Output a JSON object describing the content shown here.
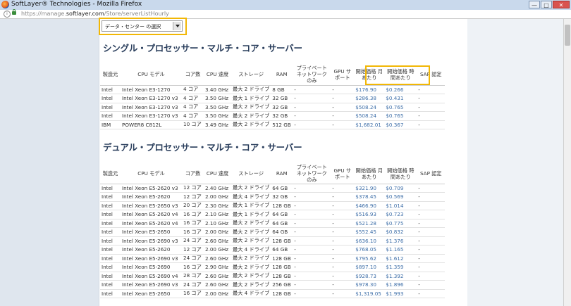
{
  "window": {
    "title": "SoftLayer® Technologies - Mozilla Firefox",
    "url_prefix": "https://manage.",
    "url_domain": "softlayer.com",
    "url_path": "/Store/serverListHourly",
    "buttons": {
      "minimize": "—",
      "maximize": "□",
      "close": "✕"
    }
  },
  "datacenter_select": {
    "selected": "データ・センター の選択"
  },
  "sections": [
    {
      "title": "シングル・プロセッサー・マルチ・コア・サーバー",
      "headers": [
        "製造元",
        "CPU モデル",
        "コア数",
        "CPU 速度",
        "ストレージ",
        "RAM",
        "プライベート ネットワーク のみ",
        "GPU サポート",
        "開始価格 月あたり",
        "開始価格 時間あたり",
        "SAP 認定"
      ],
      "rows": [
        [
          "Intel",
          "Intel Xeon E3-1270",
          "4 コア",
          "3.40 GHz",
          "最大 2 ドライブ",
          "8 GB",
          "-",
          "-",
          "$176.90",
          "$0.266",
          "-"
        ],
        [
          "Intel",
          "Intel Xeon E3-1270 v3",
          "4 コア",
          "3.50 GHz",
          "最大 1 ドライブ",
          "32 GB",
          "-",
          "-",
          "$286.38",
          "$0.431",
          "-"
        ],
        [
          "Intel",
          "Intel Xeon E3-1270 v3",
          "4 コア",
          "3.50 GHz",
          "最大 2 ドライブ",
          "32 GB",
          "-",
          "-",
          "$508.24",
          "$0.765",
          "-"
        ],
        [
          "Intel",
          "Intel Xeon E3-1270 v3",
          "4 コア",
          "3.50 GHz",
          "最大 2 ドライブ",
          "32 GB",
          "-",
          "-",
          "$508.24",
          "$0.765",
          "-"
        ],
        [
          "IBM",
          "POWER8 C812L",
          "10 コア",
          "3.49 GHz",
          "最大 2 ドライブ",
          "512 GB",
          "-",
          "-",
          "$1,682.01",
          "$0.367",
          "-"
        ]
      ]
    },
    {
      "title": "デュアル・プロセッサー・マルチ・コア・サーバー",
      "headers": [
        "製造元",
        "CPU モデル",
        "コア数",
        "CPU 速度",
        "ストレージ",
        "RAM",
        "プライベート ネットワーク のみ",
        "GPU サポート",
        "開始価格 月あたり",
        "開始価格 時間あたり",
        "SAP 認定"
      ],
      "rows": [
        [
          "Intel",
          "Intel Xeon E5-2620 v3",
          "12 コア",
          "2.40 GHz",
          "最大 2 ドライブ",
          "64 GB",
          "-",
          "-",
          "$321.90",
          "$0.709",
          "-"
        ],
        [
          "Intel",
          "Intel Xeon E5-2620",
          "12 コア",
          "2.00 GHz",
          "最大 4 ドライブ",
          "32 GB",
          "-",
          "-",
          "$378.45",
          "$0.569",
          "-"
        ],
        [
          "Intel",
          "Intel Xeon E5-2650 v3",
          "20 コア",
          "2.30 GHz",
          "最大 1 ドライブ",
          "128 GB",
          "-",
          "-",
          "$466.90",
          "$1.014",
          "-"
        ],
        [
          "Intel",
          "Intel Xeon E5-2620 v4",
          "16 コア",
          "2.10 GHz",
          "最大 1 ドライブ",
          "64 GB",
          "-",
          "-",
          "$516.93",
          "$0.723",
          "-"
        ],
        [
          "Intel",
          "Intel Xeon E5-2620 v4",
          "16 コア",
          "2.10 GHz",
          "最大 2 ドライブ",
          "64 GB",
          "-",
          "-",
          "$521.28",
          "$0.775",
          "-"
        ],
        [
          "Intel",
          "Intel Xeon E5-2650",
          "16 コア",
          "2.00 GHz",
          "最大 2 ドライブ",
          "64 GB",
          "-",
          "-",
          "$552.45",
          "$0.832",
          "-"
        ],
        [
          "Intel",
          "Intel Xeon E5-2690 v3",
          "24 コア",
          "2.60 GHz",
          "最大 2 ドライブ",
          "128 GB",
          "-",
          "-",
          "$636.10",
          "$1.376",
          "-"
        ],
        [
          "Intel",
          "Intel Xeon E5-2620",
          "12 コア",
          "2.00 GHz",
          "最大 4 ドライブ",
          "64 GB",
          "-",
          "-",
          "$768.05",
          "$1.165",
          "-"
        ],
        [
          "Intel",
          "Intel Xeon E5-2690 v3",
          "24 コア",
          "2.60 GHz",
          "最大 2 ドライブ",
          "128 GB",
          "-",
          "-",
          "$795.62",
          "$1.612",
          "-"
        ],
        [
          "Intel",
          "Intel Xeon E5-2690",
          "16 コア",
          "2.90 GHz",
          "最大 2 ドライブ",
          "128 GB",
          "-",
          "-",
          "$897.10",
          "$1.359",
          "-"
        ],
        [
          "Intel",
          "Intel Xeon E5-2690 v4",
          "28 コア",
          "2.60 GHz",
          "最大 2 ドライブ",
          "128 GB",
          "-",
          "-",
          "$928.73",
          "$1.392",
          "-"
        ],
        [
          "Intel",
          "Intel Xeon E5-2690 v3",
          "24 コア",
          "2.60 GHz",
          "最大 2 ドライブ",
          "256 GB",
          "-",
          "-",
          "$978.30",
          "$1.896",
          "-"
        ],
        [
          "Intel",
          "Intel Xeon E5-2650",
          "16 コア",
          "2.00 GHz",
          "最大 4 ドライブ",
          "128 GB",
          "-",
          "-",
          "$1,319.05",
          "$1.993",
          "-"
        ]
      ]
    }
  ],
  "colors": {
    "highlight": "#f2b705",
    "price": "#3d6ea8",
    "heading": "#2a3e5c"
  }
}
